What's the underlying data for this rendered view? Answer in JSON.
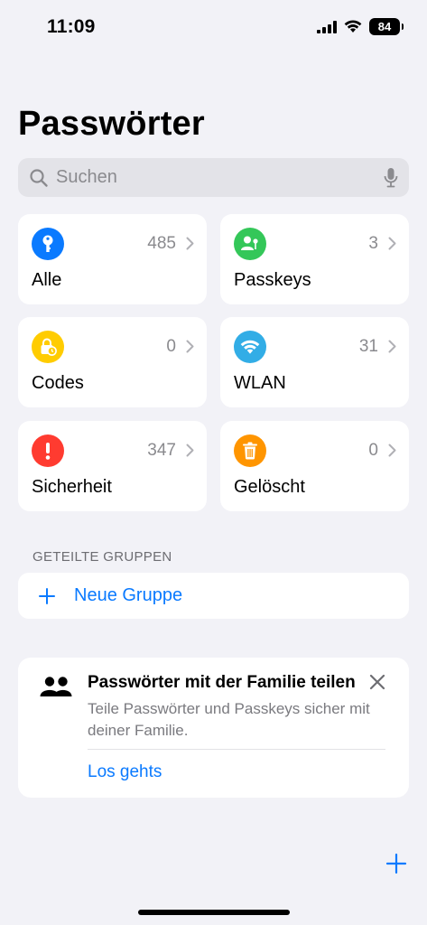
{
  "status_bar": {
    "time": "11:09",
    "battery": "84"
  },
  "title": "Passwörter",
  "search": {
    "placeholder": "Suchen"
  },
  "tiles": [
    {
      "label": "Alle",
      "count": "485",
      "color": "#0a7aff",
      "icon": "key-icon"
    },
    {
      "label": "Passkeys",
      "count": "3",
      "color": "#34c759",
      "icon": "passkey-icon"
    },
    {
      "label": "Codes",
      "count": "0",
      "color": "#ffcc00",
      "icon": "lock-clock-icon"
    },
    {
      "label": "WLAN",
      "count": "31",
      "color": "#32ade6",
      "icon": "wifi-icon"
    },
    {
      "label": "Sicherheit",
      "count": "347",
      "color": "#ff3b30",
      "icon": "exclamation-icon"
    },
    {
      "label": "Gelöscht",
      "count": "0",
      "color": "#ff9500",
      "icon": "trash-icon"
    }
  ],
  "shared_groups": {
    "header": "GETEILTE GRUPPEN",
    "new_group": "Neue Gruppe"
  },
  "family_card": {
    "title": "Passwörter mit der Familie teilen",
    "description": "Teile Passwörter und Passkeys sicher mit deiner Familie.",
    "cta": "Los gehts"
  },
  "colors": {
    "accent": "#0a7aff",
    "background": "#f2f2f7"
  }
}
